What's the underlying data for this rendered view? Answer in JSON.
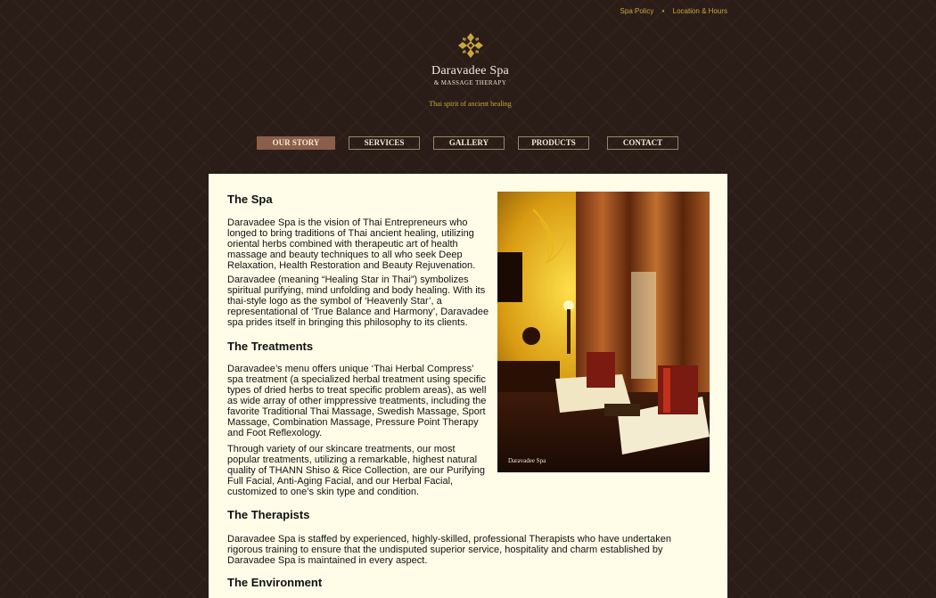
{
  "top_links": {
    "spa_policy": "Spa Policy",
    "separator": "•",
    "location_hours": "Location & Hours"
  },
  "header": {
    "brand_name": "Daravadee Spa",
    "brand_sub": "& MASSAGE THERAPY",
    "tagline": "Thai spirit of ancient healing",
    "logo_icon": "daravadee-star-logo",
    "logo_color": "#c9a73d"
  },
  "nav": {
    "items": [
      {
        "label": "OUR STORY",
        "active": true
      },
      {
        "label": "SERVICES",
        "active": false
      },
      {
        "label": "GALLERY",
        "active": false
      },
      {
        "label": "PRODUCTS",
        "active": false
      },
      {
        "label": "CONTACT",
        "active": false
      }
    ]
  },
  "content": {
    "spa_heading": "The Spa",
    "spa_p1": "Daravadee Spa is the vision of Thai Entrepreneurs who longed to bring traditions of Thai ancient healing, utilizing oriental herbs combined with therapeutic art of health massage and beauty techniques to all who seek Deep Relaxation, Health Restoration and Beauty Rejuvenation.",
    "spa_p2": "Daravadee (meaning “Healing Star in Thai”) symbolizes spiritual purifying, mind unfolding and body healing. With its thai-style logo as the symbol of ‘Heavenly Star’, a representational of ‘True Balance and Harmony’, Daravadee spa prides itself in bringing this philosophy to its clients.",
    "treatments_heading": "The Treatments",
    "treatments_p1": "Daravadee’s menu offers unique ‘Thai Herbal Compress’ spa treatment (a specialized herbal treatment using specific types of dried herbs to treat specific problem areas), as well as wide array of other imppressive treatments, including the favorite Traditional Thai Massage, Swedish Massage, Sport Massage, Combination Massage, Pressure Point Therapy and Foot Reflexology.",
    "treatments_p2": "Through variety of our skincare treatments, our most popular treatments, utilizing a remarkable, highest natural quality of THANN Shiso & Rice Collection, are our Purifying Full Facial, Anti-Aging Facial, and our Herbal Facial, customized to one’s skin type and condition.",
    "therapists_heading": "The Therapists",
    "therapists_p1": "Daravadee Spa is staffed by experienced, highly-skilled, professional Therapists who have undertaken rigorous training to ensure that the undisputed superior service, hospitality and charm established by Daravadee Spa is maintained in every aspect.",
    "environment_heading": "The Environment",
    "photo_caption": "Daravadee Spa"
  }
}
